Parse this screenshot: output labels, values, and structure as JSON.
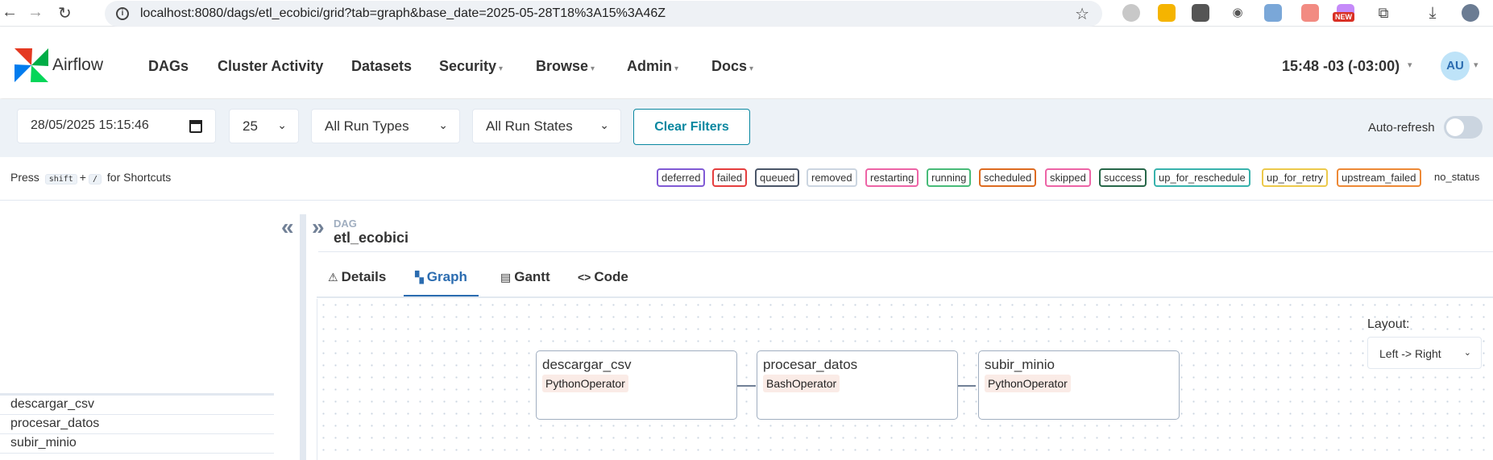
{
  "browser": {
    "url": "localhost:8080/dags/etl_ecobici/grid?tab=graph&base_date=2025-05-28T18%3A15%3A46Z",
    "new_badge": "NEW"
  },
  "header": {
    "brand": "Airflow",
    "menu": [
      "DAGs",
      "Cluster Activity",
      "Datasets",
      "Security",
      "Browse",
      "Admin",
      "Docs"
    ],
    "clock": "15:48 -03 (-03:00)",
    "avatar": "AU"
  },
  "filters": {
    "base_date": "28/05/2025  15:15:46",
    "num_runs": "25",
    "run_type": "All Run Types",
    "run_state": "All Run States",
    "clear_label": "Clear Filters",
    "autorefresh_label": "Auto-refresh",
    "autorefresh_on": false
  },
  "shortcuts": {
    "press": "Press",
    "key1": "shift",
    "plus": "+",
    "key2": "/",
    "suffix": "for Shortcuts"
  },
  "states": [
    {
      "label": "deferred",
      "color": "#805ad5"
    },
    {
      "label": "failed",
      "color": "#e53e3e"
    },
    {
      "label": "queued",
      "color": "#4a5568"
    },
    {
      "label": "removed",
      "color": "#cbd5e0"
    },
    {
      "label": "restarting",
      "color": "#ed64a6"
    },
    {
      "label": "running",
      "color": "#48bb78"
    },
    {
      "label": "scheduled",
      "color": "#dd6b20"
    },
    {
      "label": "skipped",
      "color": "#ed64a6"
    },
    {
      "label": "success",
      "color": "#276749"
    },
    {
      "label": "up_for_reschedule",
      "color": "#38b2ac"
    },
    {
      "label": "up_for_retry",
      "color": "#ecc94b"
    },
    {
      "label": "upstream_failed",
      "color": "#ed8936"
    }
  ],
  "no_status": "no_status",
  "tasks": [
    "descargar_csv",
    "procesar_datos",
    "subir_minio"
  ],
  "details": {
    "dag_label": "DAG",
    "dag_name": "etl_ecobici",
    "tabs": [
      {
        "label": "Details",
        "icon": "warning-icon"
      },
      {
        "label": "Graph",
        "icon": "graph-icon"
      },
      {
        "label": "Gantt",
        "icon": "gantt-icon"
      },
      {
        "label": "Code",
        "icon": "code-icon"
      }
    ],
    "active_tab": "Graph"
  },
  "graph": {
    "layout_label": "Layout:",
    "layout_value": "Left -> Right",
    "nodes": [
      {
        "name": "descargar_csv",
        "operator": "PythonOperator"
      },
      {
        "name": "procesar_datos",
        "operator": "BashOperator"
      },
      {
        "name": "subir_minio",
        "operator": "PythonOperator"
      }
    ]
  }
}
